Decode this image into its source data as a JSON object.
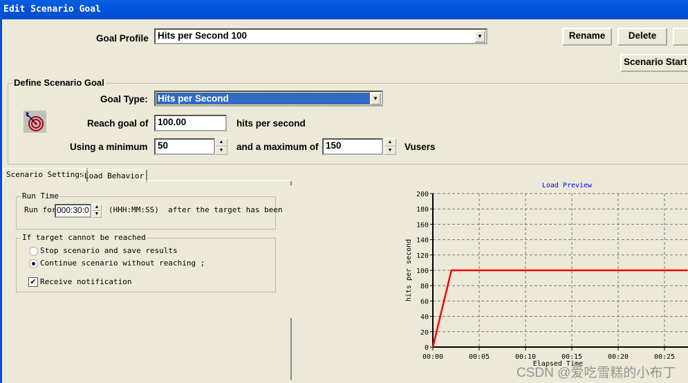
{
  "window": {
    "title": "Edit Scenario Goal"
  },
  "profile": {
    "label": "Goal Profile",
    "value": "Hits per Second 100",
    "rename": "Rename",
    "delete": "Delete",
    "scenario_start": "Scenario Start"
  },
  "define": {
    "legend": "Define Scenario Goal",
    "goal_type_label": "Goal Type:",
    "goal_type_value": "Hits per Second",
    "reach_label": "Reach goal of",
    "reach_value": "100.00",
    "reach_unit": "hits per second",
    "min_label": "Using a minimum",
    "min_value": "50",
    "max_label": "and a maximum of",
    "max_value": "150",
    "vusers_label": "Vusers",
    "icon": "target-icon"
  },
  "tabs": [
    {
      "label": "Scenario Settings",
      "active": true
    },
    {
      "label": "Load Behavior",
      "active": false
    }
  ],
  "runtime": {
    "legend": "Run Time",
    "run_for_label": "Run for",
    "run_for_value": "000:30:0",
    "hint": "(HHH:MM:SS)  after the target has been"
  },
  "unreached": {
    "legend": "If target cannot be reached",
    "options": [
      {
        "label": "Stop scenario and save results",
        "selected": false
      },
      {
        "label": "Continue scenario without reaching ;",
        "selected": true
      }
    ],
    "notify_label": "Receive notification",
    "notify_checked": true
  },
  "watermark": "CSDN @爱吃雪糕的小布丁",
  "chart_data": {
    "type": "line",
    "title": "Load Preview",
    "xlabel": "Elapsed Time",
    "ylabel": "hits per second",
    "x_ticks": [
      "00:00",
      "00:05",
      "00:10",
      "00:15",
      "00:20",
      "00:25"
    ],
    "y_ticks": [
      0,
      20,
      40,
      60,
      80,
      100,
      120,
      140,
      160,
      180,
      200
    ],
    "xlim": [
      0,
      27.5
    ],
    "ylim": [
      0,
      200
    ],
    "grid": true,
    "series": [
      {
        "x": [
          0,
          2,
          27.5
        ],
        "y": [
          0,
          100,
          100
        ],
        "color": "#ff0000"
      }
    ],
    "title_color": "#0000ff"
  }
}
